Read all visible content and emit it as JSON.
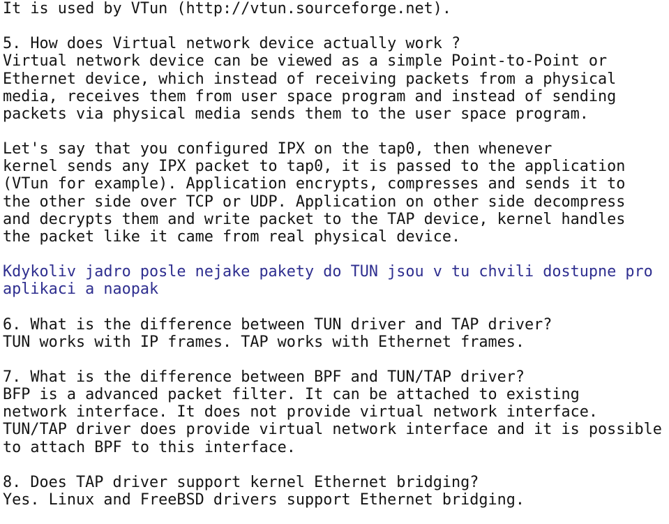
{
  "document": {
    "type": "plain-text-faq",
    "background_color": "#ffffff",
    "default_text_color": "#141414",
    "highlight_text_color": "#2e2e8f",
    "blocks": [
      {
        "id": "block-vtun-reference",
        "color": "default",
        "lines": [
          "It is used by VTun (http://vtun.sourceforge.net)."
        ]
      },
      {
        "id": "block-q5",
        "color": "default",
        "lines": [
          "5. How does Virtual network device actually work ?",
          "Virtual network device can be viewed as a simple Point-to-Point or",
          "Ethernet device, which instead of receiving packets from a physical",
          "media, receives them from user space program and instead of sending",
          "packets via physical media sends them to the user space program."
        ]
      },
      {
        "id": "block-q5-example",
        "color": "default",
        "lines": [
          "Let's say that you configured IPX on the tap0, then whenever",
          "kernel sends any IPX packet to tap0, it is passed to the application",
          "(VTun for example). Application encrypts, compresses and sends it to",
          "the other side over TCP or UDP. Application on other side decompress",
          "and decrypts them and write packet to the TAP device, kernel handles",
          "the packet like it came from real physical device."
        ]
      },
      {
        "id": "block-czech-note",
        "color": "highlight",
        "lines": [
          "Kdykoliv jadro posle nejake pakety do TUN jsou v tu chvili dostupne pro",
          "aplikaci a naopak"
        ]
      },
      {
        "id": "block-q6",
        "color": "default",
        "lines": [
          "6. What is the difference between TUN driver and TAP driver?",
          "TUN works with IP frames. TAP works with Ethernet frames."
        ]
      },
      {
        "id": "block-q7",
        "color": "default",
        "lines": [
          "7. What is the difference between BPF and TUN/TAP driver?",
          "BFP is a advanced packet filter. It can be attached to existing",
          "network interface. It does not provide virtual network interface.",
          "TUN/TAP driver does provide virtual network interface and it is possible",
          "to attach BPF to this interface."
        ]
      },
      {
        "id": "block-q8",
        "color": "default",
        "lines": [
          "8. Does TAP driver support kernel Ethernet bridging?",
          "Yes. Linux and FreeBSD drivers support Ethernet bridging."
        ]
      }
    ]
  }
}
